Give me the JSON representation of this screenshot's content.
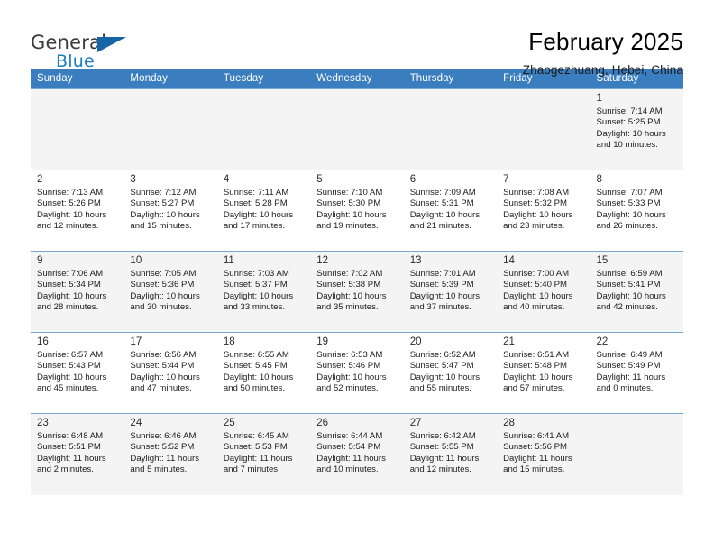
{
  "brand": {
    "name_part1": "General",
    "name_part2": "Blue",
    "logo_icon": "triangle-logo-icon"
  },
  "header": {
    "title": "February 2025",
    "subtitle": "Zhaogezhuang, Hebei, China"
  },
  "colors": {
    "header_bar": "#3b7ebf",
    "brand_blue": "#1a7ec4",
    "row_shade": "#f4f4f4",
    "grid_line": "#7aa7d0"
  },
  "weekdays": [
    "Sunday",
    "Monday",
    "Tuesday",
    "Wednesday",
    "Thursday",
    "Friday",
    "Saturday"
  ],
  "weeks": [
    {
      "shaded": true,
      "days": [
        {
          "num": "",
          "empty": true,
          "sunrise": "",
          "sunset": "",
          "daylight1": "",
          "daylight2": ""
        },
        {
          "num": "",
          "empty": true,
          "sunrise": "",
          "sunset": "",
          "daylight1": "",
          "daylight2": ""
        },
        {
          "num": "",
          "empty": true,
          "sunrise": "",
          "sunset": "",
          "daylight1": "",
          "daylight2": ""
        },
        {
          "num": "",
          "empty": true,
          "sunrise": "",
          "sunset": "",
          "daylight1": "",
          "daylight2": ""
        },
        {
          "num": "",
          "empty": true,
          "sunrise": "",
          "sunset": "",
          "daylight1": "",
          "daylight2": ""
        },
        {
          "num": "",
          "empty": true,
          "sunrise": "",
          "sunset": "",
          "daylight1": "",
          "daylight2": ""
        },
        {
          "num": "1",
          "empty": false,
          "sunrise": "Sunrise: 7:14 AM",
          "sunset": "Sunset: 5:25 PM",
          "daylight1": "Daylight: 10 hours",
          "daylight2": "and 10 minutes."
        }
      ]
    },
    {
      "shaded": false,
      "days": [
        {
          "num": "2",
          "empty": false,
          "sunrise": "Sunrise: 7:13 AM",
          "sunset": "Sunset: 5:26 PM",
          "daylight1": "Daylight: 10 hours",
          "daylight2": "and 12 minutes."
        },
        {
          "num": "3",
          "empty": false,
          "sunrise": "Sunrise: 7:12 AM",
          "sunset": "Sunset: 5:27 PM",
          "daylight1": "Daylight: 10 hours",
          "daylight2": "and 15 minutes."
        },
        {
          "num": "4",
          "empty": false,
          "sunrise": "Sunrise: 7:11 AM",
          "sunset": "Sunset: 5:28 PM",
          "daylight1": "Daylight: 10 hours",
          "daylight2": "and 17 minutes."
        },
        {
          "num": "5",
          "empty": false,
          "sunrise": "Sunrise: 7:10 AM",
          "sunset": "Sunset: 5:30 PM",
          "daylight1": "Daylight: 10 hours",
          "daylight2": "and 19 minutes."
        },
        {
          "num": "6",
          "empty": false,
          "sunrise": "Sunrise: 7:09 AM",
          "sunset": "Sunset: 5:31 PM",
          "daylight1": "Daylight: 10 hours",
          "daylight2": "and 21 minutes."
        },
        {
          "num": "7",
          "empty": false,
          "sunrise": "Sunrise: 7:08 AM",
          "sunset": "Sunset: 5:32 PM",
          "daylight1": "Daylight: 10 hours",
          "daylight2": "and 23 minutes."
        },
        {
          "num": "8",
          "empty": false,
          "sunrise": "Sunrise: 7:07 AM",
          "sunset": "Sunset: 5:33 PM",
          "daylight1": "Daylight: 10 hours",
          "daylight2": "and 26 minutes."
        }
      ]
    },
    {
      "shaded": true,
      "days": [
        {
          "num": "9",
          "empty": false,
          "sunrise": "Sunrise: 7:06 AM",
          "sunset": "Sunset: 5:34 PM",
          "daylight1": "Daylight: 10 hours",
          "daylight2": "and 28 minutes."
        },
        {
          "num": "10",
          "empty": false,
          "sunrise": "Sunrise: 7:05 AM",
          "sunset": "Sunset: 5:36 PM",
          "daylight1": "Daylight: 10 hours",
          "daylight2": "and 30 minutes."
        },
        {
          "num": "11",
          "empty": false,
          "sunrise": "Sunrise: 7:03 AM",
          "sunset": "Sunset: 5:37 PM",
          "daylight1": "Daylight: 10 hours",
          "daylight2": "and 33 minutes."
        },
        {
          "num": "12",
          "empty": false,
          "sunrise": "Sunrise: 7:02 AM",
          "sunset": "Sunset: 5:38 PM",
          "daylight1": "Daylight: 10 hours",
          "daylight2": "and 35 minutes."
        },
        {
          "num": "13",
          "empty": false,
          "sunrise": "Sunrise: 7:01 AM",
          "sunset": "Sunset: 5:39 PM",
          "daylight1": "Daylight: 10 hours",
          "daylight2": "and 37 minutes."
        },
        {
          "num": "14",
          "empty": false,
          "sunrise": "Sunrise: 7:00 AM",
          "sunset": "Sunset: 5:40 PM",
          "daylight1": "Daylight: 10 hours",
          "daylight2": "and 40 minutes."
        },
        {
          "num": "15",
          "empty": false,
          "sunrise": "Sunrise: 6:59 AM",
          "sunset": "Sunset: 5:41 PM",
          "daylight1": "Daylight: 10 hours",
          "daylight2": "and 42 minutes."
        }
      ]
    },
    {
      "shaded": false,
      "days": [
        {
          "num": "16",
          "empty": false,
          "sunrise": "Sunrise: 6:57 AM",
          "sunset": "Sunset: 5:43 PM",
          "daylight1": "Daylight: 10 hours",
          "daylight2": "and 45 minutes."
        },
        {
          "num": "17",
          "empty": false,
          "sunrise": "Sunrise: 6:56 AM",
          "sunset": "Sunset: 5:44 PM",
          "daylight1": "Daylight: 10 hours",
          "daylight2": "and 47 minutes."
        },
        {
          "num": "18",
          "empty": false,
          "sunrise": "Sunrise: 6:55 AM",
          "sunset": "Sunset: 5:45 PM",
          "daylight1": "Daylight: 10 hours",
          "daylight2": "and 50 minutes."
        },
        {
          "num": "19",
          "empty": false,
          "sunrise": "Sunrise: 6:53 AM",
          "sunset": "Sunset: 5:46 PM",
          "daylight1": "Daylight: 10 hours",
          "daylight2": "and 52 minutes."
        },
        {
          "num": "20",
          "empty": false,
          "sunrise": "Sunrise: 6:52 AM",
          "sunset": "Sunset: 5:47 PM",
          "daylight1": "Daylight: 10 hours",
          "daylight2": "and 55 minutes."
        },
        {
          "num": "21",
          "empty": false,
          "sunrise": "Sunrise: 6:51 AM",
          "sunset": "Sunset: 5:48 PM",
          "daylight1": "Daylight: 10 hours",
          "daylight2": "and 57 minutes."
        },
        {
          "num": "22",
          "empty": false,
          "sunrise": "Sunrise: 6:49 AM",
          "sunset": "Sunset: 5:49 PM",
          "daylight1": "Daylight: 11 hours",
          "daylight2": "and 0 minutes."
        }
      ]
    },
    {
      "shaded": true,
      "days": [
        {
          "num": "23",
          "empty": false,
          "sunrise": "Sunrise: 6:48 AM",
          "sunset": "Sunset: 5:51 PM",
          "daylight1": "Daylight: 11 hours",
          "daylight2": "and 2 minutes."
        },
        {
          "num": "24",
          "empty": false,
          "sunrise": "Sunrise: 6:46 AM",
          "sunset": "Sunset: 5:52 PM",
          "daylight1": "Daylight: 11 hours",
          "daylight2": "and 5 minutes."
        },
        {
          "num": "25",
          "empty": false,
          "sunrise": "Sunrise: 6:45 AM",
          "sunset": "Sunset: 5:53 PM",
          "daylight1": "Daylight: 11 hours",
          "daylight2": "and 7 minutes."
        },
        {
          "num": "26",
          "empty": false,
          "sunrise": "Sunrise: 6:44 AM",
          "sunset": "Sunset: 5:54 PM",
          "daylight1": "Daylight: 11 hours",
          "daylight2": "and 10 minutes."
        },
        {
          "num": "27",
          "empty": false,
          "sunrise": "Sunrise: 6:42 AM",
          "sunset": "Sunset: 5:55 PM",
          "daylight1": "Daylight: 11 hours",
          "daylight2": "and 12 minutes."
        },
        {
          "num": "28",
          "empty": false,
          "sunrise": "Sunrise: 6:41 AM",
          "sunset": "Sunset: 5:56 PM",
          "daylight1": "Daylight: 11 hours",
          "daylight2": "and 15 minutes."
        },
        {
          "num": "",
          "empty": true,
          "sunrise": "",
          "sunset": "",
          "daylight1": "",
          "daylight2": ""
        }
      ]
    }
  ]
}
